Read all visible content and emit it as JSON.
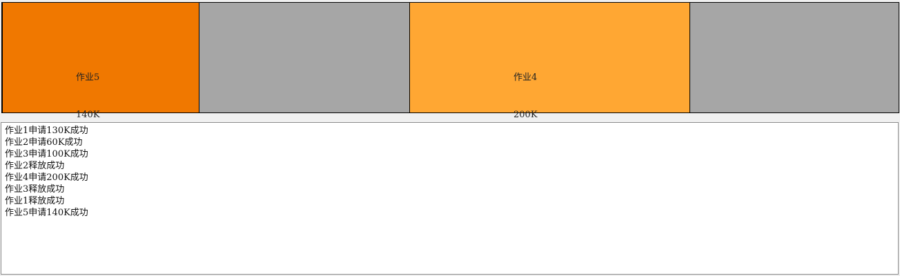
{
  "colors": {
    "job5": "#f07800",
    "free": "#a6a6a6",
    "job4": "#ffa733"
  },
  "memory": {
    "blocks": [
      {
        "job": "作业5",
        "size": "140K",
        "color": "#f07800"
      },
      {
        "job": "",
        "size": "",
        "color": "#a6a6a6"
      },
      {
        "job": "作业4",
        "size": "200K",
        "color": "#ffa733"
      },
      {
        "job": "",
        "size": "",
        "color": "#a6a6a6"
      }
    ]
  },
  "log": [
    "作业1申请130K成功",
    "作业2申请60K成功",
    "作业3申请100K成功",
    "作业2释放成功",
    "作业4申请200K成功",
    "作业3释放成功",
    "作业1释放成功",
    "作业5申请140K成功"
  ]
}
